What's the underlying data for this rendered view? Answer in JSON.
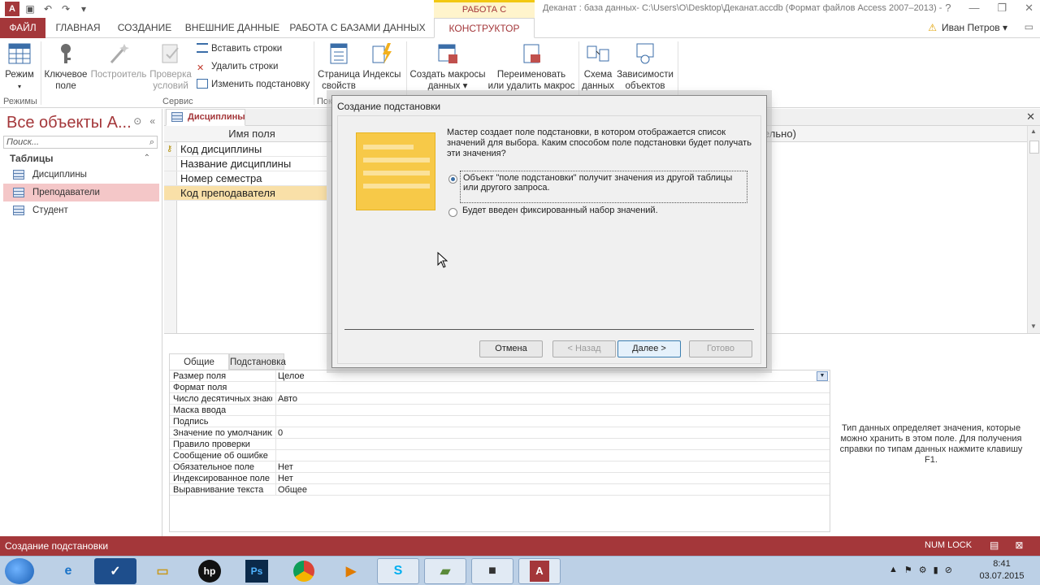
{
  "titlebar": {
    "context_tab": "РАБОТА С ТАБЛИЦАМИ",
    "title": "Деканат : база данных- C:\\Users\\O\\Desktop\\Деканат.accdb (Формат файлов Access 2007–2013) -"
  },
  "tabs": [
    "ФАЙЛ",
    "ГЛАВНАЯ",
    "СОЗДАНИЕ",
    "ВНЕШНИЕ ДАННЫЕ",
    "РАБОТА С БАЗАМИ ДАННЫХ",
    "КОНСТРУКТОР"
  ],
  "user": "Иван Петров",
  "ribbon": {
    "mode_label": "Режим",
    "key_label_1": "Ключевое",
    "key_label_2": "поле",
    "builder_label": "Построитель",
    "check_label_1": "Проверка",
    "check_label_2": "условий",
    "insert_rows": "Вставить строки",
    "delete_rows": "Удалить строки",
    "change_lookup": "Изменить подстановку",
    "props_label_1": "Страница",
    "props_label_2": "свойств",
    "indexes_label": "Индексы",
    "macros_label_1": "Создать макросы",
    "macros_label_2": "данных",
    "rename_label_1": "Переименовать",
    "rename_label_2": "или удалить макрос",
    "schema_label_1": "Схема",
    "schema_label_2": "данных",
    "deps_label_1": "Зависимости",
    "deps_label_2": "объектов",
    "group_modes": "Режимы",
    "group_service": "Сервис",
    "group_show": "Пок"
  },
  "nav": {
    "title": "Все объекты A...",
    "search_placeholder": "Поиск...",
    "group": "Таблицы",
    "items": [
      "Дисциплины",
      "Преподаватели",
      "Студент"
    ]
  },
  "document": {
    "tab": "Дисциплины",
    "col_name": "Имя поля",
    "col_right": "ельно)",
    "rows": [
      "Код дисциплины",
      "Название дисциплины",
      "Номер семестра",
      "Код преподавателя"
    ]
  },
  "properties": {
    "tab_general": "Общие",
    "tab_lookup": "Подстановка",
    "rows": [
      {
        "name": "Размер поля",
        "value": "Целое"
      },
      {
        "name": "Формат поля",
        "value": ""
      },
      {
        "name": "Число десятичных знаков",
        "value": "Авто"
      },
      {
        "name": "Маска ввода",
        "value": ""
      },
      {
        "name": "Подпись",
        "value": ""
      },
      {
        "name": "Значение по умолчанию",
        "value": "0"
      },
      {
        "name": "Правило проверки",
        "value": ""
      },
      {
        "name": "Сообщение об ошибке",
        "value": ""
      },
      {
        "name": "Обязательное поле",
        "value": "Нет"
      },
      {
        "name": "Индексированное поле",
        "value": "Нет"
      },
      {
        "name": "Выравнивание текста",
        "value": "Общее"
      }
    ],
    "help": "Тип данных определяет значения, которые можно хранить в этом поле. Для получения справки по типам данных нажмите клавишу F1."
  },
  "dialog": {
    "title": "Создание подстановки",
    "text": "Мастер создает поле подстановки, в котором отображается список значений для выбора.  Каким способом поле подстановки будет получать эти значения?",
    "option1": "Объект \"поле подстановки\" получит значения из другой таблицы или другого запроса.",
    "option2": "Будет введен фиксированный набор значений.",
    "btn_cancel": "Отмена",
    "btn_back": "< Назад",
    "btn_next": "Далее >",
    "btn_finish": "Готово"
  },
  "statusbar": {
    "left": "Создание подстановки",
    "numlock": "NUM LOCK"
  },
  "taskbar": {
    "time": "8:41",
    "date": "03.07.2015"
  },
  "colors": {
    "accent": "#a4373a",
    "selected_nav": "#f4c7c8",
    "context_tab": "#f2c811"
  }
}
